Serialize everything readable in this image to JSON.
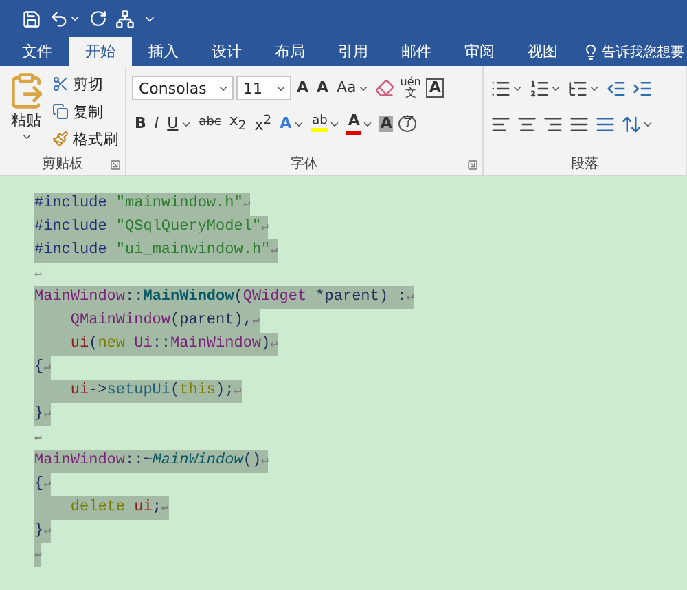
{
  "quick_access": [
    {
      "kind": "save",
      "dropdown": false
    },
    {
      "kind": "undo",
      "dropdown": true
    },
    {
      "kind": "redo",
      "dropdown": false
    },
    {
      "kind": "tree",
      "dropdown": false
    },
    {
      "kind": "customize",
      "dropdown": false
    }
  ],
  "tabs": [
    {
      "label": "文件",
      "selected": false
    },
    {
      "label": "开始",
      "selected": true
    },
    {
      "label": "插入",
      "selected": false
    },
    {
      "label": "设计",
      "selected": false
    },
    {
      "label": "布局",
      "selected": false
    },
    {
      "label": "引用",
      "selected": false
    },
    {
      "label": "邮件",
      "selected": false
    },
    {
      "label": "审阅",
      "selected": false
    },
    {
      "label": "视图",
      "selected": false
    }
  ],
  "tell_me": "告诉我您想要",
  "clipboard": {
    "label": "剪贴板",
    "paste": "粘贴",
    "items": [
      {
        "kind": "cut",
        "label": "剪切"
      },
      {
        "kind": "copy",
        "label": "复制"
      },
      {
        "kind": "painter",
        "label": "格式刷"
      }
    ]
  },
  "font": {
    "label": "字体",
    "font_name": "Consolas",
    "font_size": "11",
    "row1": [
      {
        "kind": "grow",
        "text": "A",
        "dropdown": false
      },
      {
        "kind": "shrink",
        "text": "A",
        "dropdown": false
      },
      {
        "kind": "case",
        "text": "Aa",
        "dropdown": true
      },
      {
        "kind": "clear",
        "dropdown": false
      },
      {
        "kind": "pinyin",
        "text": "uén",
        "sub": "文",
        "dropdown": false
      },
      {
        "kind": "border",
        "text": "A",
        "dropdown": false
      }
    ],
    "row2": [
      {
        "kind": "bold",
        "text": "B",
        "dropdown": false
      },
      {
        "kind": "italic",
        "text": "I",
        "dropdown": false
      },
      {
        "kind": "underline",
        "text": "U",
        "dropdown": true
      },
      {
        "kind": "strike",
        "text": "abc",
        "dropdown": false
      },
      {
        "kind": "sub",
        "text": "x$_{2}$",
        "dropdown": false
      },
      {
        "kind": "sup",
        "text": "x$^{2}$",
        "dropdown": false
      },
      {
        "kind": "effect",
        "text": "A",
        "dropdown": true
      },
      {
        "kind": "highlight",
        "text": "ab",
        "dropdown": true
      },
      {
        "kind": "color",
        "text": "A",
        "dropdown": true
      },
      {
        "kind": "shading",
        "text": "A",
        "dropdown": false
      },
      {
        "kind": "enclose",
        "text": "字",
        "dropdown": false
      }
    ]
  },
  "paragraph": {
    "label": "段落",
    "row1": [
      {
        "kind": "bullets",
        "dropdown": true
      },
      {
        "kind": "numbering",
        "dropdown": true
      },
      {
        "kind": "multilevel",
        "dropdown": true
      },
      {
        "kind": "outdent",
        "dropdown": false
      },
      {
        "kind": "indent",
        "dropdown": false
      }
    ],
    "row2": [
      {
        "kind": "left",
        "dropdown": false
      },
      {
        "kind": "center",
        "dropdown": false
      },
      {
        "kind": "right",
        "dropdown": false
      },
      {
        "kind": "justify",
        "dropdown": false
      },
      {
        "kind": "distribute",
        "dropdown": false
      },
      {
        "kind": "spacing",
        "dropdown": true
      }
    ]
  },
  "document": {
    "para_mark": "↵",
    "lines": [
      {
        "highlighted": true,
        "indent": false,
        "tokens": [
          {
            "kind": "preproc",
            "text": "#include "
          },
          {
            "kind": "string",
            "text": "\"mainwindow.h\""
          }
        ]
      },
      {
        "highlighted": true,
        "indent": false,
        "tokens": [
          {
            "kind": "preproc",
            "text": "#include "
          },
          {
            "kind": "string",
            "text": "\"QSqlQueryModel\""
          }
        ]
      },
      {
        "highlighted": true,
        "indent": false,
        "tokens": [
          {
            "kind": "preproc",
            "text": "#include "
          },
          {
            "kind": "string",
            "text": "\"ui_mainwindow.h\""
          }
        ]
      },
      {
        "highlighted": false,
        "indent": false
      },
      {
        "highlighted": true,
        "indent": false,
        "tokens": [
          {
            "kind": "type",
            "text": "MainWindow"
          },
          {
            "kind": "plain",
            "text": "::"
          },
          {
            "kind": "func",
            "text": "MainWindow"
          },
          {
            "kind": "plain",
            "text": "("
          },
          {
            "kind": "type",
            "text": "QWidget"
          },
          {
            "kind": "plain",
            "text": " *parent) :"
          }
        ]
      },
      {
        "highlighted": true,
        "indent": true,
        "tokens": [
          {
            "kind": "type",
            "text": "QMainWindow"
          },
          {
            "kind": "plain",
            "text": "(parent),"
          }
        ]
      },
      {
        "highlighted": true,
        "indent": true,
        "tokens": [
          {
            "kind": "member",
            "text": "ui"
          },
          {
            "kind": "plain",
            "text": "("
          },
          {
            "kind": "keyword",
            "text": "new "
          },
          {
            "kind": "type",
            "text": "Ui"
          },
          {
            "kind": "plain",
            "text": "::"
          },
          {
            "kind": "type",
            "text": "MainWindow"
          },
          {
            "kind": "plain",
            "text": ")"
          }
        ]
      },
      {
        "highlighted": true,
        "indent": false,
        "tokens": [
          {
            "kind": "plain",
            "text": "{"
          }
        ]
      },
      {
        "highlighted": true,
        "indent": true,
        "tokens": [
          {
            "kind": "member",
            "text": "ui"
          },
          {
            "kind": "plain",
            "text": "->"
          },
          {
            "kind": "call",
            "text": "setupUi"
          },
          {
            "kind": "plain",
            "text": "("
          },
          {
            "kind": "keyword",
            "text": "this"
          },
          {
            "kind": "plain",
            "text": ");"
          }
        ]
      },
      {
        "highlighted": true,
        "indent": false,
        "tokens": [
          {
            "kind": "plain",
            "text": "}"
          }
        ]
      },
      {
        "highlighted": false,
        "indent": false
      },
      {
        "highlighted": true,
        "indent": false,
        "tokens": [
          {
            "kind": "type",
            "text": "MainWindow"
          },
          {
            "kind": "plain",
            "text": "::~"
          },
          {
            "kind": "dtor",
            "text": "MainWindow"
          },
          {
            "kind": "plain",
            "text": "()"
          }
        ]
      },
      {
        "highlighted": true,
        "indent": false,
        "tokens": [
          {
            "kind": "plain",
            "text": "{"
          }
        ]
      },
      {
        "highlighted": true,
        "indent": true,
        "tokens": [
          {
            "kind": "keyword",
            "text": "delete "
          },
          {
            "kind": "member",
            "text": "ui"
          },
          {
            "kind": "plain",
            "text": ";"
          }
        ]
      },
      {
        "highlighted": true,
        "indent": false,
        "tokens": [
          {
            "kind": "plain",
            "text": "}"
          }
        ]
      },
      {
        "highlighted": true,
        "indent": false
      }
    ]
  }
}
